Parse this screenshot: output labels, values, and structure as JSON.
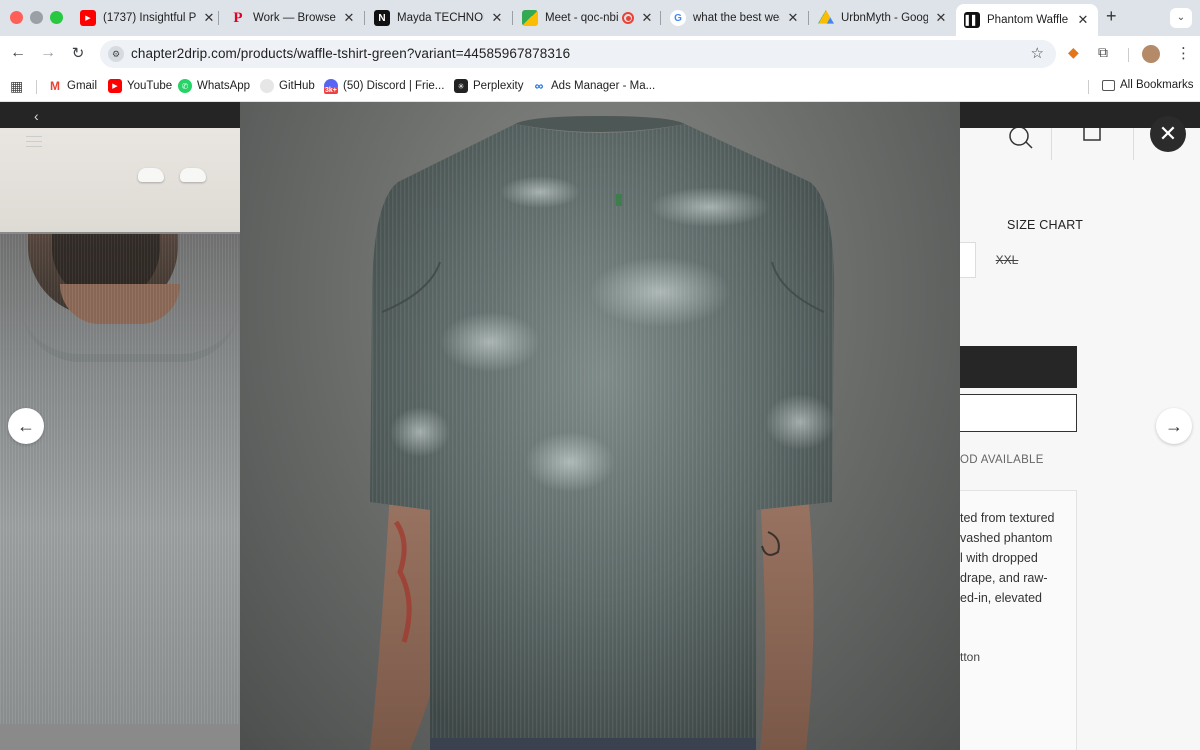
{
  "browser": {
    "tabs": [
      {
        "title": "(1737) Insightful P",
        "favicon": "youtube-icon"
      },
      {
        "title": "Work — Browse by",
        "favicon": "pinterest-icon"
      },
      {
        "title": "Mayda TECHNOLO",
        "favicon": "notion-icon"
      },
      {
        "title": "Meet - qoc-nbi",
        "favicon": "meet-icon"
      },
      {
        "title": "what the best wea",
        "favicon": "google-icon"
      },
      {
        "title": "UrbnMyth - Googl",
        "favicon": "drive-icon"
      },
      {
        "title": "Phantom Waffle T",
        "favicon": "site-icon",
        "active": true
      }
    ],
    "new_tab": "+",
    "url": "chapter2drip.com/products/waffle-tshirt-green?variant=44585967878316",
    "bookmarks": [
      {
        "label": "Gmail",
        "icon": "gmail-icon"
      },
      {
        "label": "YouTube",
        "icon": "youtube-icon"
      },
      {
        "label": "WhatsApp",
        "icon": "whatsapp-icon"
      },
      {
        "label": "GitHub",
        "icon": "github-icon"
      },
      {
        "label": "(50) Discord | Frie...",
        "icon": "discord-icon"
      },
      {
        "label": "Perplexity",
        "icon": "perplexity-icon"
      },
      {
        "label": "Ads Manager - Ma...",
        "icon": "meta-icon"
      }
    ],
    "all_bookmarks": "All Bookmarks"
  },
  "page": {
    "size_chart": "SIZE CHART",
    "size_option": "XXL",
    "cod_text": "OD AVAILABLE",
    "description_lines": [
      "ted from textured",
      "vashed phantom",
      "l with dropped",
      "drape, and raw-",
      "ed-in, elevated"
    ],
    "material": "tton"
  },
  "lightbox": {
    "close": "✕",
    "prev": "←",
    "next": "→"
  },
  "colors": {
    "tee": "#5f6b69",
    "background": "#6e706e",
    "header": "#252525"
  }
}
